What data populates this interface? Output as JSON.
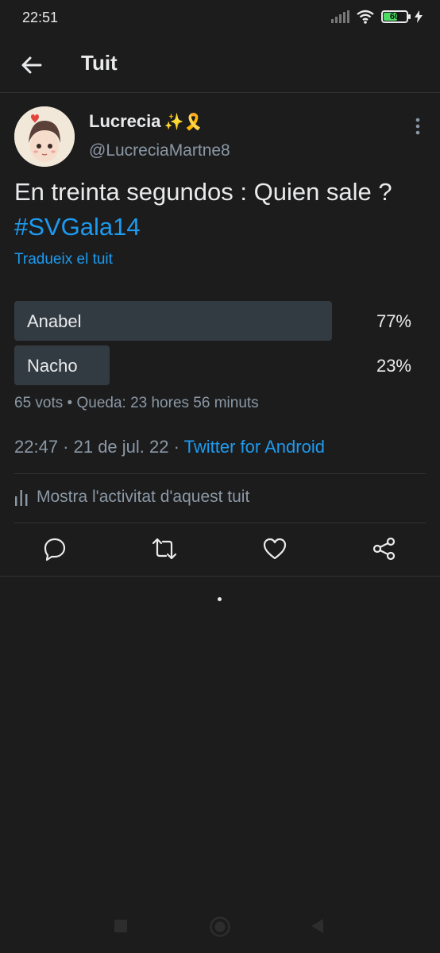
{
  "status_bar": {
    "time": "22:51",
    "battery": "60"
  },
  "header": {
    "title": "Tuit"
  },
  "user": {
    "name": "Lucrecia",
    "emoji": "✨🎗️",
    "handle": "@LucreciaMartne8"
  },
  "tweet": {
    "text": "En treinta segundos : Quien sale ? ",
    "hashtag": "#SVGala14",
    "translate_label": "Tradueix el tuit"
  },
  "poll": {
    "options": [
      {
        "label": "Anabel",
        "percent_text": "77%",
        "percent": 77
      },
      {
        "label": "Nacho",
        "percent_text": "23%",
        "percent": 23
      }
    ],
    "meta": "65 vots • Queda: 23 hores 56 minuts"
  },
  "timestamp": {
    "time_date": "22:47 · 21 de jul. 22 · ",
    "source": "Twitter for Android"
  },
  "activity": {
    "label": "Mostra l'activitat d'aquest tuit"
  },
  "icons": {
    "back": "arrow-left-icon",
    "more": "more-vertical-icon",
    "reply": "reply-icon",
    "retweet": "retweet-icon",
    "like": "heart-icon",
    "share": "share-icon",
    "activity": "bar-chart-icon"
  },
  "colors": {
    "background": "#1c1c1d",
    "accent": "#1d9bf0",
    "poll_bar": "#333b42",
    "muted_text": "#8b98a5"
  }
}
